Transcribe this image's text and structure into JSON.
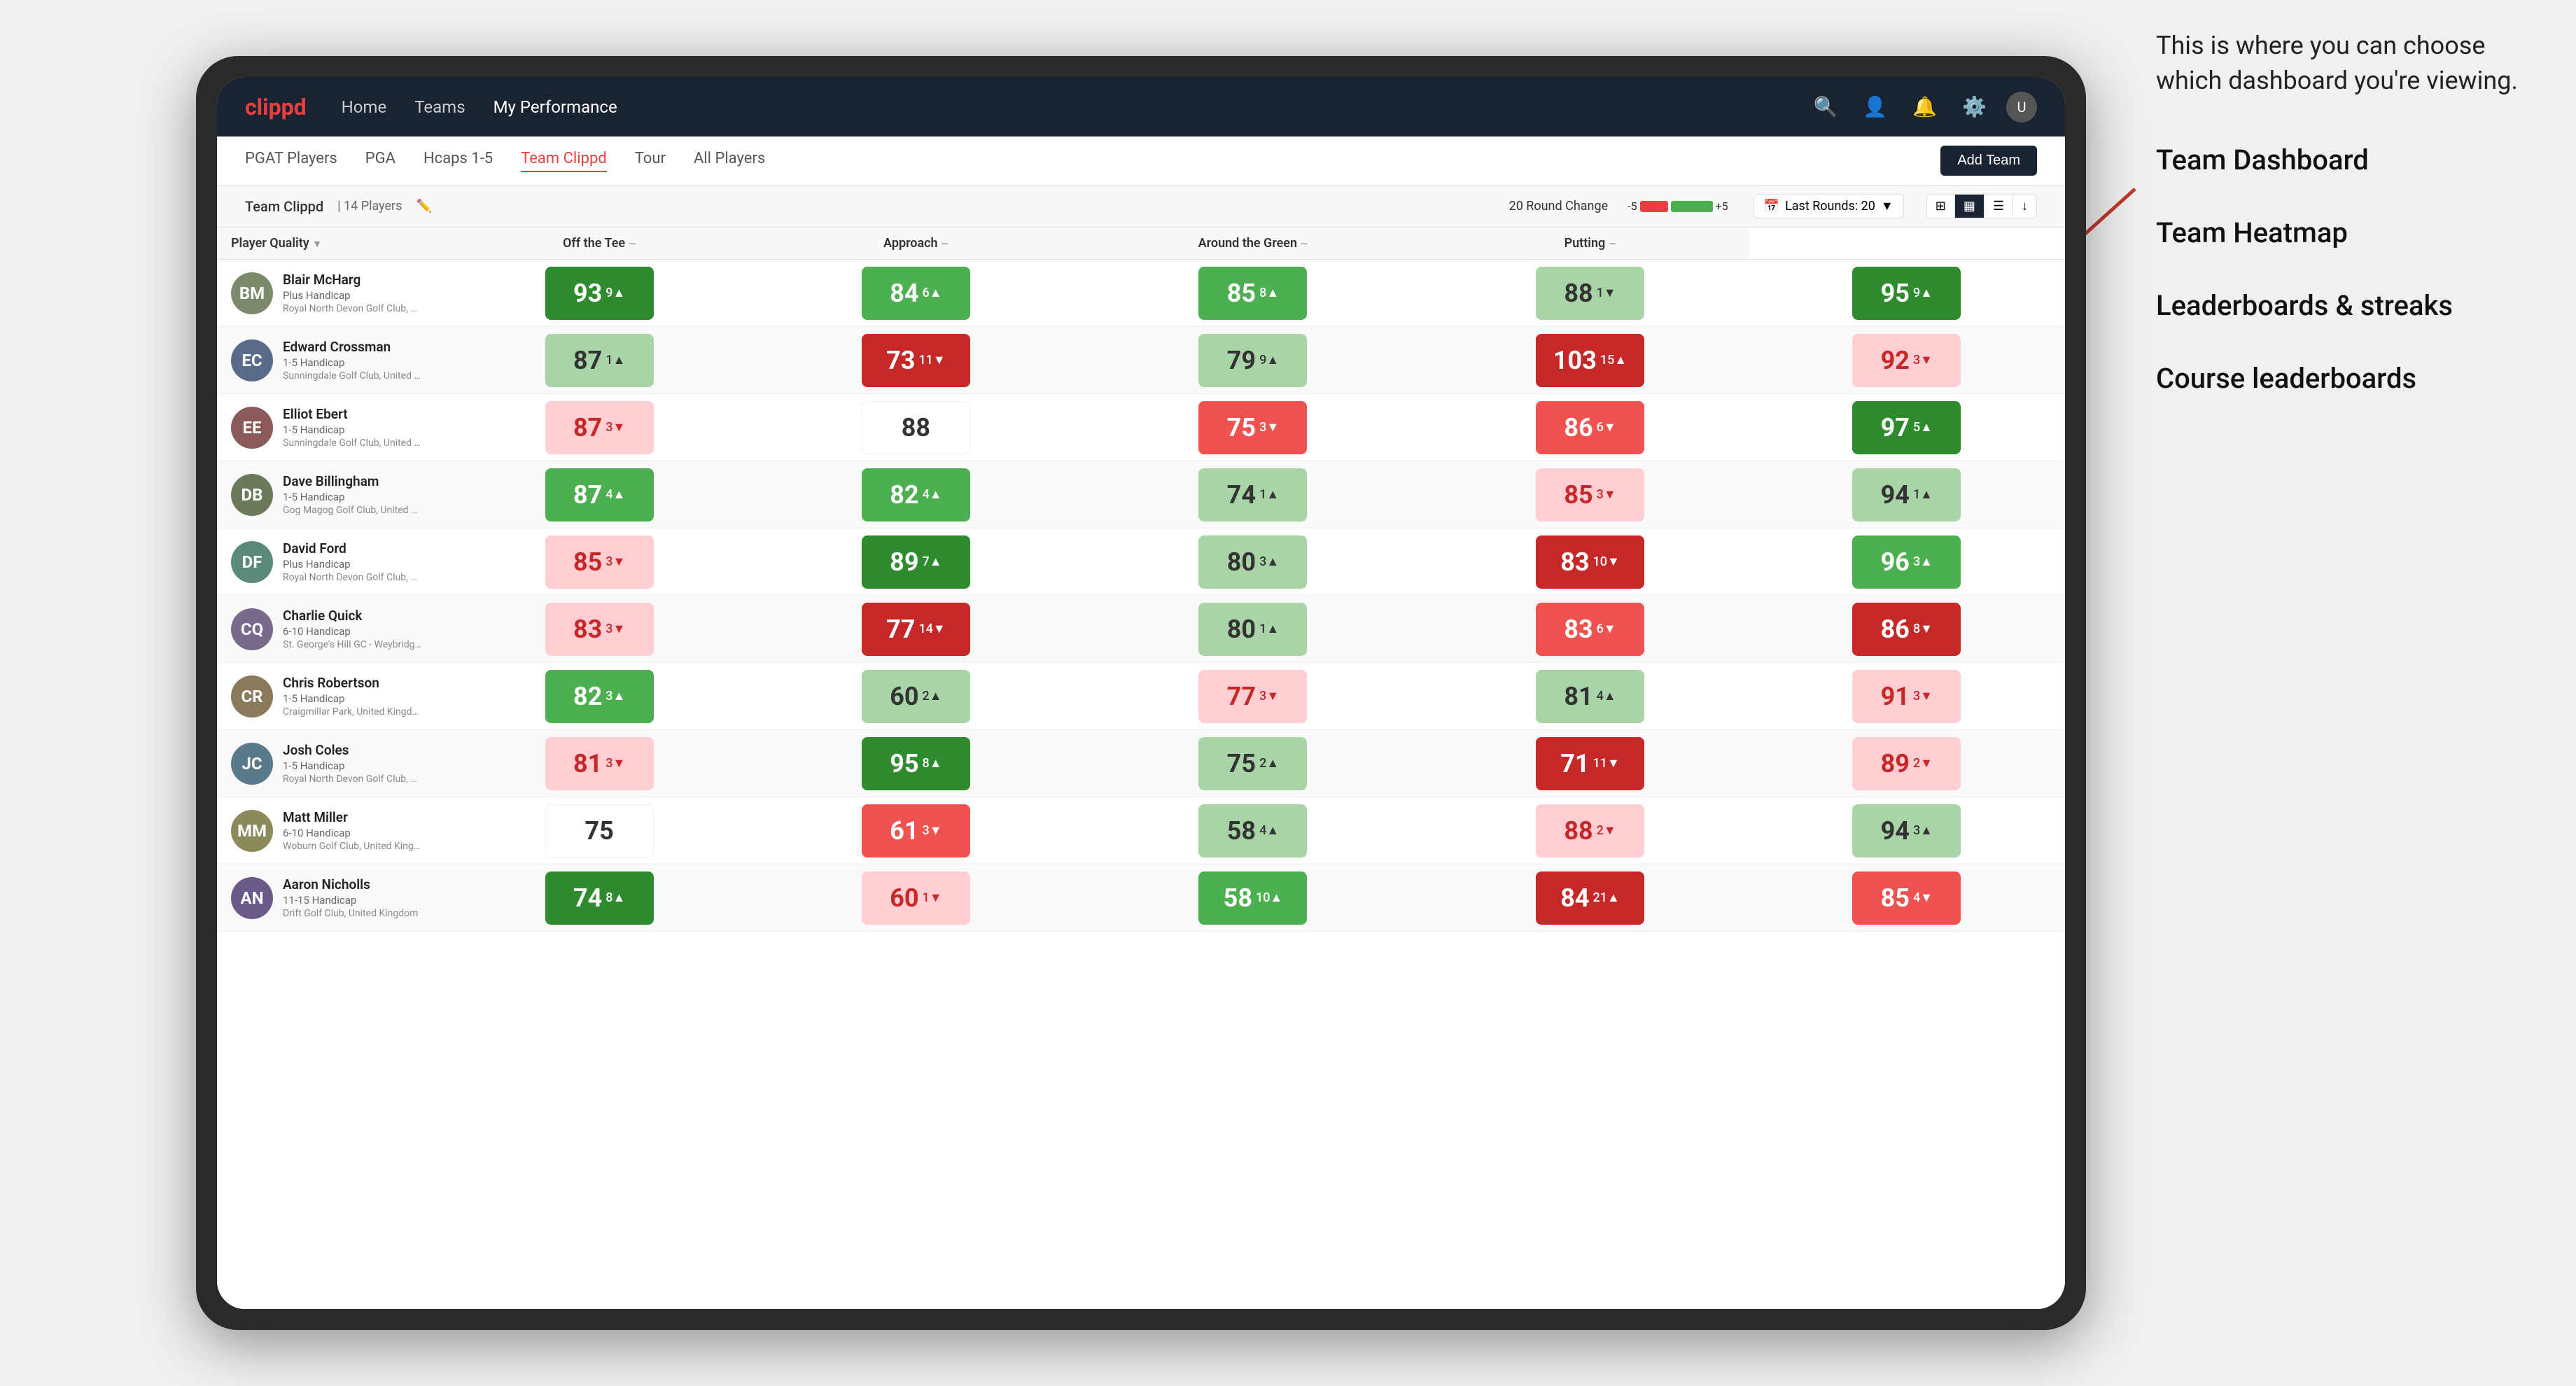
{
  "annotation": {
    "intro_text": "This is where you can choose which dashboard you're viewing.",
    "options": [
      "Team Dashboard",
      "Team Heatmap",
      "Leaderboards & streaks",
      "Course leaderboards"
    ]
  },
  "navbar": {
    "logo": "clippd",
    "links": [
      {
        "label": "Home",
        "active": false
      },
      {
        "label": "Teams",
        "active": false
      },
      {
        "label": "My Performance",
        "active": true
      }
    ],
    "icons": [
      "search",
      "person",
      "notifications",
      "settings",
      "avatar"
    ]
  },
  "subnav": {
    "links": [
      {
        "label": "PGAT Players",
        "active": false
      },
      {
        "label": "PGA",
        "active": false
      },
      {
        "label": "Hcaps 1-5",
        "active": false
      },
      {
        "label": "Team Clippd",
        "active": true
      },
      {
        "label": "Tour",
        "active": false
      },
      {
        "label": "All Players",
        "active": false
      }
    ],
    "add_team_label": "Add Team"
  },
  "team_header": {
    "name": "Team Clippd",
    "separator": "|",
    "players_count": "14 Players",
    "round_change_label": "20 Round Change",
    "bar_neg_label": "-5",
    "bar_pos_label": "+5",
    "last_rounds_label": "Last Rounds:",
    "last_rounds_value": "20",
    "view_options": [
      "grid",
      "list",
      "heatmap",
      "export"
    ]
  },
  "table": {
    "columns": [
      {
        "label": "Player Quality",
        "sortable": true
      },
      {
        "label": "Off the Tee",
        "sortable": true
      },
      {
        "label": "Approach",
        "sortable": true
      },
      {
        "label": "Around the Green",
        "sortable": true
      },
      {
        "label": "Putting",
        "sortable": true
      }
    ],
    "players": [
      {
        "name": "Blair McHarg",
        "handicap": "Plus Handicap",
        "club": "Royal North Devon Golf Club, United Kingdom",
        "avatar_color": "#7a8a6a",
        "avatar_initials": "BM",
        "scores": [
          {
            "value": "93",
            "delta": "9",
            "dir": "up",
            "color": "green-dark"
          },
          {
            "value": "84",
            "delta": "6",
            "dir": "up",
            "color": "green-mid"
          },
          {
            "value": "85",
            "delta": "8",
            "dir": "up",
            "color": "green-mid"
          },
          {
            "value": "88",
            "delta": "1",
            "dir": "down",
            "color": "green-light"
          },
          {
            "value": "95",
            "delta": "9",
            "dir": "up",
            "color": "green-dark"
          }
        ]
      },
      {
        "name": "Edward Crossman",
        "handicap": "1-5 Handicap",
        "club": "Sunningdale Golf Club, United Kingdom",
        "avatar_color": "#5a6a8a",
        "avatar_initials": "EC",
        "scores": [
          {
            "value": "87",
            "delta": "1",
            "dir": "up",
            "color": "green-light"
          },
          {
            "value": "73",
            "delta": "11",
            "dir": "down",
            "color": "red-dark"
          },
          {
            "value": "79",
            "delta": "9",
            "dir": "up",
            "color": "green-light"
          },
          {
            "value": "103",
            "delta": "15",
            "dir": "up",
            "color": "red-dark"
          },
          {
            "value": "92",
            "delta": "3",
            "dir": "down",
            "color": "red-light"
          }
        ]
      },
      {
        "name": "Elliot Ebert",
        "handicap": "1-5 Handicap",
        "club": "Sunningdale Golf Club, United Kingdom",
        "avatar_color": "#8a5a5a",
        "avatar_initials": "EE",
        "scores": [
          {
            "value": "87",
            "delta": "3",
            "dir": "down",
            "color": "red-light"
          },
          {
            "value": "88",
            "delta": "",
            "dir": "",
            "color": "white"
          },
          {
            "value": "75",
            "delta": "3",
            "dir": "down",
            "color": "red-mid"
          },
          {
            "value": "86",
            "delta": "6",
            "dir": "down",
            "color": "red-mid"
          },
          {
            "value": "97",
            "delta": "5",
            "dir": "up",
            "color": "green-dark"
          }
        ]
      },
      {
        "name": "Dave Billingham",
        "handicap": "1-5 Handicap",
        "club": "Gog Magog Golf Club, United Kingdom",
        "avatar_color": "#6a7a5a",
        "avatar_initials": "DB",
        "scores": [
          {
            "value": "87",
            "delta": "4",
            "dir": "up",
            "color": "green-mid"
          },
          {
            "value": "82",
            "delta": "4",
            "dir": "up",
            "color": "green-mid"
          },
          {
            "value": "74",
            "delta": "1",
            "dir": "up",
            "color": "green-light"
          },
          {
            "value": "85",
            "delta": "3",
            "dir": "down",
            "color": "red-light"
          },
          {
            "value": "94",
            "delta": "1",
            "dir": "up",
            "color": "green-light"
          }
        ]
      },
      {
        "name": "David Ford",
        "handicap": "Plus Handicap",
        "club": "Royal North Devon Golf Club, United Kingdom",
        "avatar_color": "#5a8a7a",
        "avatar_initials": "DF",
        "scores": [
          {
            "value": "85",
            "delta": "3",
            "dir": "down",
            "color": "red-light"
          },
          {
            "value": "89",
            "delta": "7",
            "dir": "up",
            "color": "green-dark"
          },
          {
            "value": "80",
            "delta": "3",
            "dir": "up",
            "color": "green-light"
          },
          {
            "value": "83",
            "delta": "10",
            "dir": "down",
            "color": "red-dark"
          },
          {
            "value": "96",
            "delta": "3",
            "dir": "up",
            "color": "green-mid"
          }
        ]
      },
      {
        "name": "Charlie Quick",
        "handicap": "6-10 Handicap",
        "club": "St. George's Hill GC - Weybridge - Surrey, Uni...",
        "avatar_color": "#7a6a8a",
        "avatar_initials": "CQ",
        "scores": [
          {
            "value": "83",
            "delta": "3",
            "dir": "down",
            "color": "red-light"
          },
          {
            "value": "77",
            "delta": "14",
            "dir": "down",
            "color": "red-dark"
          },
          {
            "value": "80",
            "delta": "1",
            "dir": "up",
            "color": "green-light"
          },
          {
            "value": "83",
            "delta": "6",
            "dir": "down",
            "color": "red-mid"
          },
          {
            "value": "86",
            "delta": "8",
            "dir": "down",
            "color": "red-dark"
          }
        ]
      },
      {
        "name": "Chris Robertson",
        "handicap": "1-5 Handicap",
        "club": "Craigmillar Park, United Kingdom",
        "avatar_color": "#8a7a5a",
        "avatar_initials": "CR",
        "scores": [
          {
            "value": "82",
            "delta": "3",
            "dir": "up",
            "color": "green-mid"
          },
          {
            "value": "60",
            "delta": "2",
            "dir": "up",
            "color": "green-light"
          },
          {
            "value": "77",
            "delta": "3",
            "dir": "down",
            "color": "red-light"
          },
          {
            "value": "81",
            "delta": "4",
            "dir": "up",
            "color": "green-light"
          },
          {
            "value": "91",
            "delta": "3",
            "dir": "down",
            "color": "red-light"
          }
        ]
      },
      {
        "name": "Josh Coles",
        "handicap": "1-5 Handicap",
        "club": "Royal North Devon Golf Club, United Kingdom",
        "avatar_color": "#5a7a8a",
        "avatar_initials": "JC",
        "scores": [
          {
            "value": "81",
            "delta": "3",
            "dir": "down",
            "color": "red-light"
          },
          {
            "value": "95",
            "delta": "8",
            "dir": "up",
            "color": "green-dark"
          },
          {
            "value": "75",
            "delta": "2",
            "dir": "up",
            "color": "green-light"
          },
          {
            "value": "71",
            "delta": "11",
            "dir": "down",
            "color": "red-dark"
          },
          {
            "value": "89",
            "delta": "2",
            "dir": "down",
            "color": "red-light"
          }
        ]
      },
      {
        "name": "Matt Miller",
        "handicap": "6-10 Handicap",
        "club": "Woburn Golf Club, United Kingdom",
        "avatar_color": "#8a8a5a",
        "avatar_initials": "MM",
        "scores": [
          {
            "value": "75",
            "delta": "",
            "dir": "",
            "color": "white"
          },
          {
            "value": "61",
            "delta": "3",
            "dir": "down",
            "color": "red-mid"
          },
          {
            "value": "58",
            "delta": "4",
            "dir": "up",
            "color": "green-light"
          },
          {
            "value": "88",
            "delta": "2",
            "dir": "down",
            "color": "red-light"
          },
          {
            "value": "94",
            "delta": "3",
            "dir": "up",
            "color": "green-light"
          }
        ]
      },
      {
        "name": "Aaron Nicholls",
        "handicap": "11-15 Handicap",
        "club": "Drift Golf Club, United Kingdom",
        "avatar_color": "#6a5a8a",
        "avatar_initials": "AN",
        "scores": [
          {
            "value": "74",
            "delta": "8",
            "dir": "up",
            "color": "green-dark"
          },
          {
            "value": "60",
            "delta": "1",
            "dir": "down",
            "color": "red-light"
          },
          {
            "value": "58",
            "delta": "10",
            "dir": "up",
            "color": "green-mid"
          },
          {
            "value": "84",
            "delta": "21",
            "dir": "up",
            "color": "red-dark"
          },
          {
            "value": "85",
            "delta": "4",
            "dir": "down",
            "color": "red-mid"
          }
        ]
      }
    ]
  }
}
